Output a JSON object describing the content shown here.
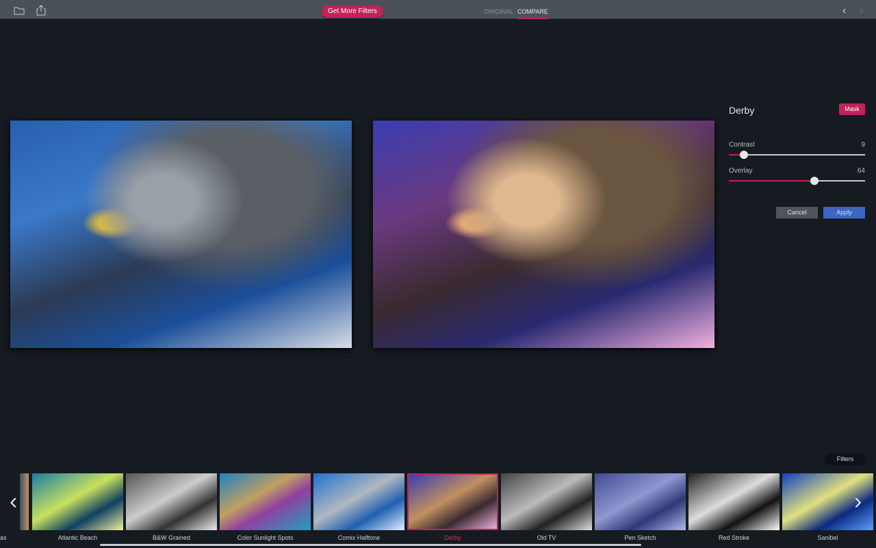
{
  "topbar": {
    "get_more": "Get More Filters",
    "tab_original": "ORIGINAL",
    "tab_compare": "COMPARE",
    "active_tab": "COMPARE"
  },
  "panel": {
    "title": "Derby",
    "mask": "Mask",
    "sliders": [
      {
        "label": "Contrast",
        "value": 9,
        "display": "9"
      },
      {
        "label": "Overlay",
        "value": 64,
        "display": "64"
      }
    ],
    "cancel": "Cancel",
    "apply": "Apply"
  },
  "filters_button": "Filters",
  "filters": [
    {
      "label": "as",
      "partial": true
    },
    {
      "label": "Atlantic Beach"
    },
    {
      "label": "B&W Grained"
    },
    {
      "label": "Color Sunlight Spots"
    },
    {
      "label": "Comix Halftone"
    },
    {
      "label": "Derby",
      "selected": true
    },
    {
      "label": "Old TV"
    },
    {
      "label": "Pen Sketch"
    },
    {
      "label": "Red Stroke"
    },
    {
      "label": "Sanibel"
    }
  ],
  "colors": {
    "accent": "#c0225a",
    "apply": "#3d66c4"
  }
}
